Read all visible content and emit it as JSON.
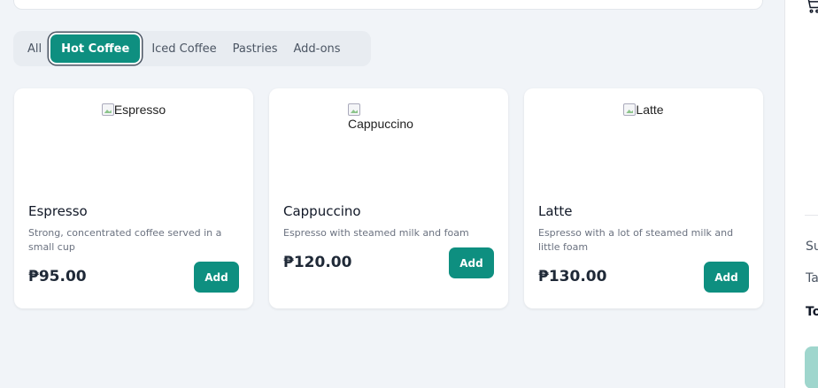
{
  "categories": {
    "items": [
      "All",
      "Hot Coffee",
      "Iced Coffee",
      "Pastries",
      "Add-ons"
    ],
    "active": "Hot Coffee"
  },
  "products": [
    {
      "image_alt": "Espresso",
      "name": "Espresso",
      "description": "Strong, concentrated coffee served in a small cup",
      "price": "₱95.00",
      "add_label": "Add"
    },
    {
      "image_alt": "Cappuccino",
      "name": "Cappuccino",
      "description": "Espresso with steamed milk and foam",
      "price": "₱120.00",
      "add_label": "Add"
    },
    {
      "image_alt": "Latte",
      "name": "Latte",
      "description": "Espresso with a lot of steamed milk and little foam",
      "price": "₱130.00",
      "add_label": "Add"
    }
  ],
  "cart": {
    "icon": "shopping-cart-icon",
    "subtotal_label": "Su",
    "tax_label": "Ta",
    "total_label": "To"
  },
  "colors": {
    "accent": "#0e8f80",
    "background": "#f1f4f8",
    "checkout_disabled": "#9fd6cd"
  }
}
